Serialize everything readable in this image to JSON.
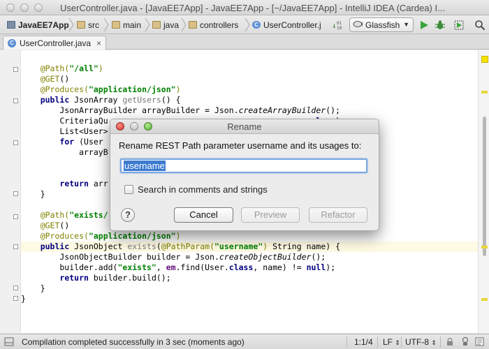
{
  "window": {
    "title": "UserController.java - [JavaEE7App] - JavaEE7App - [~/JavaEE7App] - IntelliJ IDEA (Cardea) I..."
  },
  "navbar": {
    "breadcrumbs": [
      "JavaEE7App",
      "src",
      "main",
      "java",
      "controllers",
      "UserController.j"
    ],
    "run_config": "Glassfish"
  },
  "tabs": [
    {
      "label": "UserController.java",
      "close": "×"
    }
  ],
  "code": {
    "lines": [
      "",
      "    @Path(\"/all\")",
      "    @GET()",
      "    @Produces(\"application/json\")",
      "    public JsonArray getUsers() {",
      "        JsonArrayBuilder arrayBuilder = Json.createArrayBuilder();",
      "        CriteriaQu                                      ser.class);",
      "        List<User>",
      "        for (User",
      "            arrayB",
      "",
      "",
      "        return arr",
      "    }",
      "",
      "    @Path(\"exists/",
      "    @GET()",
      "    @Produces(\"application/json\")",
      "    public JsonObject exists(@PathParam(\"username\") String name) {",
      "        JsonObjectBuilder builder = Json.createObjectBuilder();",
      "        builder.add(\"exists\", em.find(User.class, name) != null);",
      "        return builder.build();",
      "    }",
      "}"
    ]
  },
  "status": {
    "message": "Compilation completed successfully in 3 sec (moments ago)",
    "position": "1:1/4",
    "line_sep": "LF",
    "encoding": "UTF-8"
  },
  "dialog": {
    "title": "Rename",
    "prompt": "Rename REST Path parameter username and its usages to:",
    "input_value": "username",
    "checkbox_label": "Search in comments and strings",
    "help": "?",
    "cancel": "Cancel",
    "preview": "Preview",
    "refactor": "Refactor"
  }
}
